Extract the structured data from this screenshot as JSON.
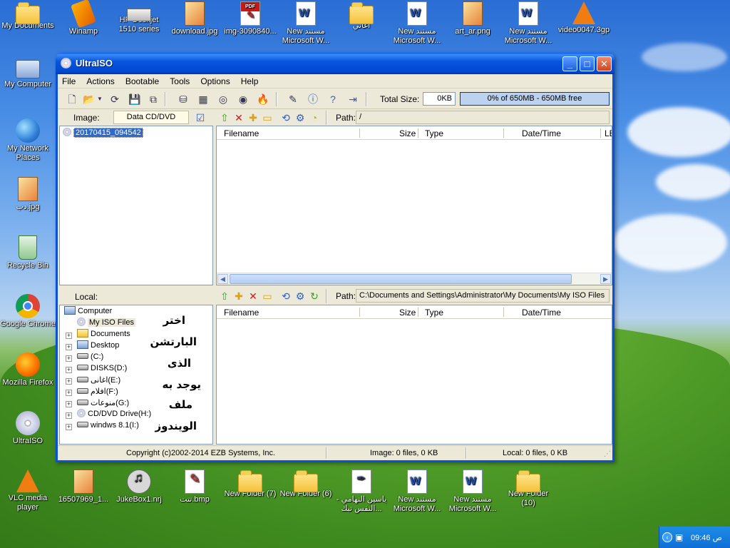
{
  "desktop": {
    "top_icons": [
      {
        "label": "My Documents",
        "icon": "folder-icon"
      },
      {
        "label": "Winamp",
        "icon": "winamp-icon"
      },
      {
        "label": "HP Deskjet 1510 series",
        "icon": "printer-icon"
      },
      {
        "label": "download.jpg",
        "icon": "image-icon"
      },
      {
        "label": "img-3090840...",
        "icon": "pdf-icon"
      },
      {
        "label": "New مستند Microsoft W...",
        "icon": "word-doc-icon"
      },
      {
        "label": "اغاني",
        "icon": "folder-icon"
      },
      {
        "label": "New مستند Microsoft W...",
        "icon": "word-doc-icon"
      },
      {
        "label": "art_ar.png",
        "icon": "image-icon"
      },
      {
        "label": "New مستند Microsoft W...",
        "icon": "word-doc-icon"
      },
      {
        "label": "video0047.3gp",
        "icon": "vlc-icon"
      }
    ],
    "left_icons": [
      {
        "label": "My Computer",
        "icon": "computer-icon"
      },
      {
        "label": "My Network Places",
        "icon": "network-icon"
      },
      {
        "label": "دب.jpg",
        "icon": "image-icon"
      },
      {
        "label": "Recycle Bin",
        "icon": "recycle-bin-icon"
      },
      {
        "label": "Google Chrome",
        "icon": "chrome-icon"
      },
      {
        "label": "Mozilla Firefox",
        "icon": "firefox-icon"
      },
      {
        "label": "UltraISO",
        "icon": "ultraiso-icon"
      }
    ],
    "bottom_icons": [
      {
        "label": "VLC media player",
        "icon": "vlc-icon"
      },
      {
        "label": "16507969_1...",
        "icon": "image-icon"
      },
      {
        "label": "JukeBox1.nrj",
        "icon": "music-icon"
      },
      {
        "label": "تتت.bmp",
        "icon": "bmp-icon"
      },
      {
        "label": "New Folder (7)",
        "icon": "folder-icon"
      },
      {
        "label": "New Folder (6)",
        "icon": "folder-icon"
      },
      {
        "label": "ياسين التهامي - النفس تبك...",
        "icon": "document-icon"
      },
      {
        "label": "New مستند Microsoft W...",
        "icon": "word-doc-icon"
      },
      {
        "label": "New مستند Microsoft W...",
        "icon": "word-doc-icon"
      },
      {
        "label": "New Folder (10)",
        "icon": "folder-icon"
      }
    ]
  },
  "window": {
    "title": "UltraISO",
    "menu": [
      "File",
      "Actions",
      "Bootable",
      "Tools",
      "Options",
      "Help"
    ],
    "toolbar": {
      "total_size_label": "Total Size:",
      "total_size_value": "0KB",
      "capacity_text": "0% of 650MB - 650MB free"
    },
    "image_panel": {
      "label": "Image:",
      "type_value": "Data CD/DVD",
      "root_node": "20170415_094542",
      "path_label": "Path:",
      "path_value": "/",
      "columns": [
        "Filename",
        "Size",
        "Type",
        "Date/Time",
        "LE"
      ]
    },
    "local_panel": {
      "label": "Local:",
      "path_label": "Path:",
      "path_value": "C:\\Documents and Settings\\Administrator\\My Documents\\My ISO Files",
      "columns": [
        "Filename",
        "Size",
        "Type",
        "Date/Time"
      ],
      "tree": [
        {
          "label": "Computer",
          "icon": "computer-icon"
        },
        {
          "label": "My ISO Files",
          "icon": "cd-icon"
        },
        {
          "label": "Documents",
          "icon": "folder-icon"
        },
        {
          "label": "Desktop",
          "icon": "desktop-icon"
        },
        {
          "label": "(C:)",
          "icon": "drive-icon"
        },
        {
          "label": "DISKS(D:)",
          "icon": "drive-icon"
        },
        {
          "label": "اغانى(E:)",
          "icon": "drive-icon"
        },
        {
          "label": "افلام(F:)",
          "icon": "drive-icon"
        },
        {
          "label": "منوعات(G:)",
          "icon": "drive-icon"
        },
        {
          "label": "CD/DVD Drive(H:)",
          "icon": "cd-drive-icon"
        },
        {
          "label": "windws 8.1(I:)",
          "icon": "drive-icon"
        }
      ],
      "annotation_lines": [
        "اختر",
        "البارتشن",
        "الذى",
        "يوجد به",
        "ملف",
        "الويندوز"
      ]
    },
    "status": {
      "copyright": "Copyright (c)2002-2014 EZB Systems, Inc.",
      "image_info": "Image: 0 files, 0 KB",
      "local_info": "Local: 0 files, 0 KB"
    }
  },
  "taskbar": {
    "clock": "09:46 ص"
  }
}
